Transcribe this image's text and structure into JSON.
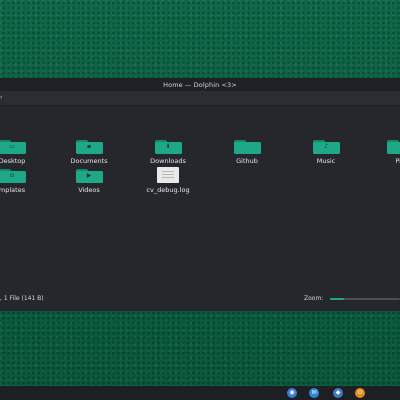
{
  "window": {
    "title": "Home — Dolphin <3>"
  },
  "toolbar": {
    "back_glyph": "›"
  },
  "items": [
    {
      "label": "Desktop",
      "type": "folder"
    },
    {
      "label": "Documents",
      "type": "folder"
    },
    {
      "label": "Downloads",
      "type": "folder"
    },
    {
      "label": "Github",
      "type": "folder"
    },
    {
      "label": "Music",
      "type": "folder"
    },
    {
      "label": "Pic",
      "type": "folder"
    },
    {
      "label": "mplates",
      "type": "folder"
    },
    {
      "label": "Videos",
      "type": "folder"
    },
    {
      "label": "cv_debug.log",
      "type": "file"
    }
  ],
  "status": {
    "summary": ", 1 File (141 B)",
    "zoom_label": "Zoom:",
    "zoom_level": 0.2
  },
  "colors": {
    "accent": "#1ea888",
    "window_bg": "#25272d",
    "desktop_green": "#0b5e40"
  },
  "taskbar": {
    "tray": [
      {
        "name": "network-icon",
        "color": "#3a7bd5"
      },
      {
        "name": "chat-icon",
        "color": "#2f86d6"
      },
      {
        "name": "mail-icon",
        "color": "#3d7ac9"
      },
      {
        "name": "power-icon",
        "color": "#e58a1c"
      }
    ]
  }
}
